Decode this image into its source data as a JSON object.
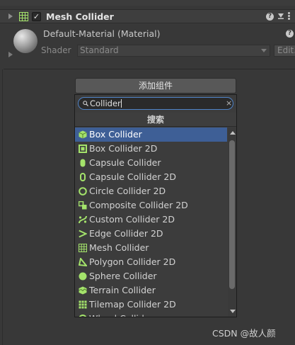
{
  "component": {
    "title": "Mesh Collider",
    "enabled_mark": "✓",
    "help_glyph": "?",
    "icon": "mesh-grid-icon"
  },
  "material": {
    "name": "Default-Material (Material)",
    "shader_label": "Shader",
    "shader_value": "Standard",
    "edit_label": "Edit..."
  },
  "add_component": {
    "button_label": "添加组件",
    "search_value": "Collider",
    "clear_glyph": "×",
    "section_title": "搜索",
    "items": [
      {
        "label": "Box Collider",
        "icon": "box-collider-icon",
        "selected": true
      },
      {
        "label": "Box Collider 2D",
        "icon": "box-collider-2d-icon"
      },
      {
        "label": "Capsule Collider",
        "icon": "capsule-collider-icon"
      },
      {
        "label": "Capsule Collider 2D",
        "icon": "capsule-collider-2d-icon"
      },
      {
        "label": "Circle Collider 2D",
        "icon": "circle-collider-2d-icon"
      },
      {
        "label": "Composite Collider 2D",
        "icon": "composite-collider-2d-icon"
      },
      {
        "label": "Custom Collider 2D",
        "icon": "custom-collider-2d-icon"
      },
      {
        "label": "Edge Collider 2D",
        "icon": "edge-collider-2d-icon"
      },
      {
        "label": "Mesh Collider",
        "icon": "mesh-collider-icon"
      },
      {
        "label": "Polygon Collider 2D",
        "icon": "polygon-collider-2d-icon"
      },
      {
        "label": "Sphere Collider",
        "icon": "sphere-collider-icon"
      },
      {
        "label": "Terrain Collider",
        "icon": "terrain-collider-icon"
      },
      {
        "label": "Tilemap Collider 2D",
        "icon": "tilemap-collider-2d-icon"
      },
      {
        "label": "Wheel Collider",
        "icon": "wheel-collider-icon"
      }
    ]
  },
  "watermark": "CSDN @故人颜",
  "colors": {
    "background": "#383838",
    "selection": "#3e5f96",
    "icon_green": "#a4e36b",
    "search_focus": "#4f83c7"
  }
}
